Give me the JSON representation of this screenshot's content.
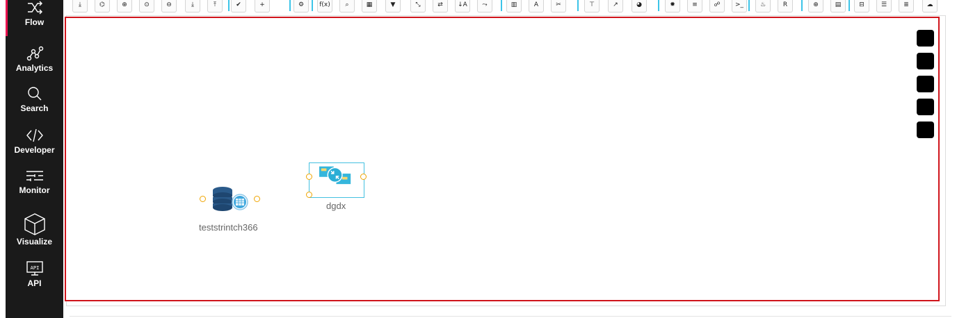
{
  "sidebar": {
    "items": [
      {
        "label": "Flow",
        "icon": "shuffle-icon"
      },
      {
        "label": "Analytics",
        "icon": "analytics-network-icon"
      },
      {
        "label": "Search",
        "icon": "search-icon"
      },
      {
        "label": "Developer",
        "icon": "code-brackets-icon"
      },
      {
        "label": "Monitor",
        "icon": "monitor-sliders-icon"
      },
      {
        "label": "Visualize",
        "icon": "cube-icon"
      },
      {
        "label": "API",
        "icon": "api-screen-icon",
        "badge": "API"
      }
    ],
    "active": "Flow"
  },
  "toolbar": {
    "buttons": [
      {
        "name": "download-icon",
        "glyph": "⤓"
      },
      {
        "name": "tag-icon",
        "glyph": "⌬"
      },
      {
        "name": "add-circle-icon",
        "glyph": "⊕"
      },
      {
        "name": "target-icon",
        "glyph": "⊙"
      },
      {
        "name": "remove-circle-icon",
        "glyph": "⊖"
      },
      {
        "name": "import-icon",
        "glyph": "⤓"
      },
      {
        "name": "export-icon",
        "glyph": "⤒"
      },
      {
        "name": "check-icon",
        "glyph": "✔"
      },
      {
        "name": "plus-icon",
        "glyph": "+"
      },
      {
        "name": "cogs-icon",
        "glyph": "⚙"
      },
      {
        "name": "function-icon",
        "glyph": "f(x)"
      },
      {
        "name": "search-icon",
        "glyph": "⌕"
      },
      {
        "name": "table-swap-icon",
        "glyph": "▦"
      },
      {
        "name": "filter-icon",
        "glyph": "▼"
      },
      {
        "name": "collapse-icon",
        "glyph": "⤡"
      },
      {
        "name": "swap-icon",
        "glyph": "⇄"
      },
      {
        "name": "sort-az-icon",
        "glyph": "↓A"
      },
      {
        "name": "split-icon",
        "glyph": "⤳"
      },
      {
        "name": "bar-chart-icon",
        "glyph": "▥"
      },
      {
        "name": "font-icon",
        "glyph": "A"
      },
      {
        "name": "scissors-icon",
        "glyph": "✂"
      },
      {
        "name": "hierarchy-icon",
        "glyph": "⊤"
      },
      {
        "name": "line-chart-icon",
        "glyph": "↗"
      },
      {
        "name": "pie-chart-icon",
        "glyph": "◕"
      },
      {
        "name": "gear-icon",
        "glyph": "✹"
      },
      {
        "name": "database-icon",
        "glyph": "≡"
      },
      {
        "name": "handshake-icon",
        "glyph": "☍"
      },
      {
        "name": "terminal-icon",
        "glyph": ">_"
      },
      {
        "name": "java-icon",
        "glyph": "♨"
      },
      {
        "name": "r-language-icon",
        "glyph": "R"
      },
      {
        "name": "globe-icon",
        "glyph": "⊕"
      },
      {
        "name": "file-icon",
        "glyph": "▤"
      },
      {
        "name": "cylinder-icon",
        "glyph": "⊟"
      },
      {
        "name": "list-indent-icon",
        "glyph": "☰"
      },
      {
        "name": "stack-icon",
        "glyph": "≣"
      },
      {
        "name": "cloud-db-icon",
        "glyph": "☁"
      }
    ]
  },
  "canvas": {
    "nodes": [
      {
        "name": "teststrintch366",
        "type": "database-source"
      },
      {
        "name": "dgdx",
        "type": "transform",
        "selected": true
      }
    ]
  },
  "colors": {
    "sidebar_bg": "#1a1a1a",
    "accent": "#e8124f",
    "canvas_border": "#d0141b",
    "port": "#f0a500",
    "toolbar_sep": "#3cc4e8"
  }
}
